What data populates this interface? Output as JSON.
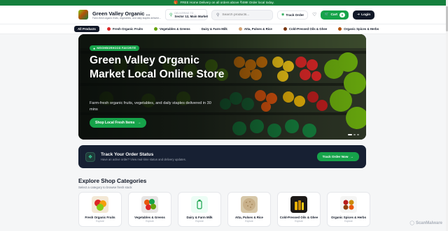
{
  "promo": {
    "icon": "gift-icon",
    "text": "FREE Home Delivery on all orders above ₹499! Order local today."
  },
  "header": {
    "brand_name": "Green Valley Organic ...",
    "brand_tagline": "Farm-fresh organic fruits, vegetables, and daily staples delivere...",
    "delivery_label": "DELIVERING TO",
    "delivery_value": "Sector 12, Main Market",
    "search_placeholder": "Search products...",
    "track_label": "Track Order",
    "cart_label": "Cart",
    "cart_count": "0",
    "login_label": "Login"
  },
  "categories_nav": [
    {
      "label": "All Products",
      "active": true,
      "color": ""
    },
    {
      "label": "Fresh Organic Fruits",
      "active": false,
      "color": "#dc2626"
    },
    {
      "label": "Vegetables & Greens",
      "active": false,
      "color": "#65a30d"
    },
    {
      "label": "Dairy & Farm Milk",
      "active": false,
      "color": ""
    },
    {
      "label": "Atta, Pulses & Rice",
      "active": false,
      "color": "#d4a373"
    },
    {
      "label": "Cold-Pressed Oils & Ghee",
      "active": false,
      "color": "#78350f"
    },
    {
      "label": "Organic Spices & Herbs",
      "active": false,
      "color": "#b45309"
    }
  ],
  "hero": {
    "badge": "NEIGHBORHOOD FAVORITE",
    "title": "Green Valley Organic Market Local Online Store",
    "subtitle": "Farm-fresh organic fruits, vegetables, and daily staples delivered in 30 mins",
    "cta": "Shop Local Fresh Items",
    "slides_total": 3,
    "slide_active": 1
  },
  "track": {
    "title": "Track Your Order Status",
    "desc": "Have an active order? View real-time status and delivery updates.",
    "button": "Track Order Now"
  },
  "explore": {
    "title": "Explore Shop Categories",
    "subtitle": "Select a category to browse fresh stock"
  },
  "category_cards": [
    {
      "name": "Fresh Organic Fruits",
      "action": "Explore"
    },
    {
      "name": "Vegetables & Greens",
      "action": "Explore"
    },
    {
      "name": "Dairy & Farm Milk",
      "action": "Explore"
    },
    {
      "name": "Atta, Pulses & Rice",
      "action": "Explore"
    },
    {
      "name": "Cold-Pressed Oils & Ghee",
      "action": "Explore"
    },
    {
      "name": "Organic Spices & Herbs",
      "action": "Explore"
    }
  ],
  "watermark": "ScanMalware",
  "colors": {
    "primary": "#16a34a",
    "dark": "#111827",
    "navy": "#172033",
    "promo": "#15803d"
  }
}
